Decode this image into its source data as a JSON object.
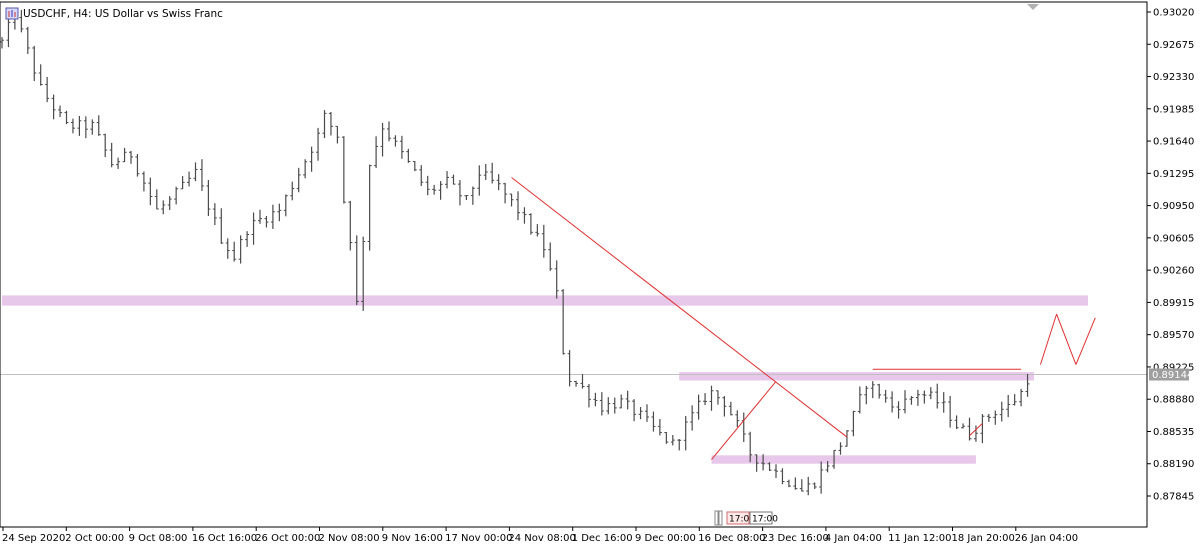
{
  "chart_data": {
    "type": "ohlc",
    "symbol": "USDCHF",
    "timeframe": "H4",
    "description": "US Dollar vs Swiss Franc",
    "title": "USDCHF, H4:  US Dollar vs Swiss Franc",
    "current_price": "0.89144",
    "y_ticks": [
      "0.93020",
      "0.92675",
      "0.92330",
      "0.91985",
      "0.91640",
      "0.91295",
      "0.90950",
      "0.90605",
      "0.90260",
      "0.89915",
      "0.89570",
      "0.89225",
      "0.88880",
      "0.88535",
      "0.88190",
      "0.87845"
    ],
    "x_ticks": [
      "24 Sep 2020",
      "2 Oct 00:00",
      "9 Oct 08:00",
      "16 Oct 16:00",
      "26 Oct 00:00",
      "2 Nov 08:00",
      "9 Nov 16:00",
      "17 Nov 00:00",
      "24 Nov 08:00",
      "1 Dec 16:00",
      "9 Dec 00:00",
      "16 Dec 08:00",
      "23 Dec 16:00",
      "4 Jan 04:00",
      "11 Jan 12:00",
      "18 Jan 20:00",
      "26 Jan 04:00"
    ],
    "time_tags": [
      "17:00",
      "17:00"
    ],
    "price_path": [
      [
        0,
        0.927
      ],
      [
        2,
        0.93
      ],
      [
        4,
        0.926
      ],
      [
        6,
        0.922
      ],
      [
        10,
        0.918
      ],
      [
        14,
        0.918
      ],
      [
        17,
        0.914
      ],
      [
        20,
        0.915
      ],
      [
        24,
        0.909
      ],
      [
        26,
        0.91
      ],
      [
        30,
        0.913
      ],
      [
        34,
        0.906
      ],
      [
        36,
        0.904
      ],
      [
        38,
        0.907
      ],
      [
        40,
        0.908
      ],
      [
        43,
        0.909
      ],
      [
        46,
        0.913
      ],
      [
        49,
        0.917
      ],
      [
        50,
        0.919
      ],
      [
        52,
        0.917
      ],
      [
        53,
        0.91
      ],
      [
        54,
        0.906
      ],
      [
        55,
        0.899
      ],
      [
        56,
        0.906
      ],
      [
        57,
        0.914
      ],
      [
        59,
        0.918
      ],
      [
        61,
        0.916
      ],
      [
        64,
        0.913
      ],
      [
        66,
        0.911
      ],
      [
        69,
        0.912
      ],
      [
        72,
        0.91
      ],
      [
        74,
        0.913
      ],
      [
        77,
        0.9115
      ],
      [
        80,
        0.909
      ],
      [
        82,
        0.907
      ],
      [
        84,
        0.905
      ],
      [
        86,
        0.9
      ],
      [
        87,
        0.894
      ],
      [
        88,
        0.891
      ],
      [
        90,
        0.89
      ],
      [
        93,
        0.888
      ],
      [
        96,
        0.8885
      ],
      [
        99,
        0.887
      ],
      [
        102,
        0.885
      ],
      [
        104,
        0.884
      ],
      [
        106,
        0.886
      ],
      [
        109,
        0.889
      ],
      [
        110,
        0.8895
      ],
      [
        112,
        0.8885
      ],
      [
        114,
        0.886
      ],
      [
        116,
        0.883
      ],
      [
        118,
        0.882
      ],
      [
        120,
        0.881
      ],
      [
        122,
        0.88
      ],
      [
        124,
        0.879
      ],
      [
        126,
        0.88
      ],
      [
        128,
        0.882
      ],
      [
        130,
        0.884
      ],
      [
        132,
        0.887
      ],
      [
        134,
        0.8905
      ],
      [
        136,
        0.8895
      ],
      [
        138,
        0.888
      ],
      [
        140,
        0.8885
      ],
      [
        142,
        0.8895
      ],
      [
        144,
        0.889
      ],
      [
        146,
        0.888
      ],
      [
        148,
        0.886
      ],
      [
        150,
        0.885
      ],
      [
        152,
        0.8865
      ],
      [
        154,
        0.8875
      ],
      [
        156,
        0.888
      ],
      [
        158,
        0.8895
      ],
      [
        159,
        0.891
      ]
    ],
    "zones": [
      {
        "x0": 0,
        "x1": 170,
        "y0": 0.8999,
        "y1": 0.8988
      },
      {
        "x0": 105,
        "x1": 160,
        "y0": 0.8917,
        "y1": 0.8908
      },
      {
        "x0": 110,
        "x1": 151,
        "y0": 0.8828,
        "y1": 0.8819
      }
    ],
    "lines": [
      {
        "x0": 79,
        "y0": 0.9125,
        "x1": 131,
        "y1": 0.88475
      },
      {
        "x0": 110,
        "y0": 0.88235,
        "x1": 120,
        "y1": 0.8907
      },
      {
        "x0": 135,
        "y0": 0.892,
        "x1": 158,
        "y1": 0.892
      },
      {
        "x0": 150,
        "y0": 0.8849,
        "x1": 152,
        "y1": 0.8862
      },
      {
        "x0": 161,
        "y0": 0.8925,
        "x1": 163.5,
        "y1": 0.8979
      },
      {
        "x0": 163.5,
        "y0": 0.8979,
        "x1": 166.5,
        "y1": 0.8925
      },
      {
        "x0": 166.5,
        "y0": 0.8925,
        "x1": 169.5,
        "y1": 0.8975
      }
    ],
    "colors": {
      "bar": "#4a4a4a",
      "line": "#e03030",
      "zone": "#e8c8ea",
      "axis": "#000000",
      "price_line": "#c0c0c0",
      "tag_bg": "#9e9e9e",
      "tag_border": "#d07070"
    }
  }
}
